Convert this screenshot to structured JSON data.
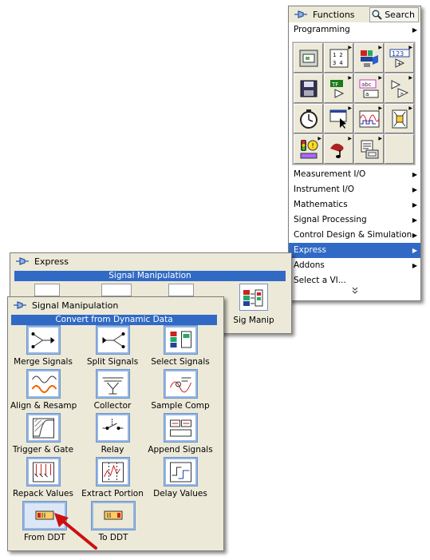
{
  "functions": {
    "title": "Functions",
    "search_label": "Search",
    "top_item": "Programming",
    "items": [
      "Measurement I/O",
      "Instrument I/O",
      "Mathematics",
      "Signal Processing",
      "Control Design & Simulation",
      "Express",
      "Addons",
      "Select a VI..."
    ],
    "selected_index": 5,
    "more_glyph": "»",
    "icons": [
      "structures-icon",
      "array-icon",
      "cluster-icon",
      "numeric-icon",
      "file-io-icon",
      "boolean-icon",
      "string-icon",
      "comparison-icon",
      "timing-icon",
      "dialog-icon",
      "waveform-icon",
      "application-control-icon",
      "synchronization-icon",
      "graphics-sound-icon",
      "report-generation-icon"
    ]
  },
  "express": {
    "title": "Express",
    "band": "Signal Manipulation",
    "partial_label": "Sig Manip"
  },
  "signal_manip": {
    "title": "Signal Manipulation",
    "band": "Convert from Dynamic Data",
    "tiles": [
      "Merge Signals",
      "Split Signals",
      "Select Signals",
      "Align & Resamp",
      "Collector",
      "Sample Comp",
      "Trigger & Gate",
      "Relay",
      "Append Signals",
      "Repack Values",
      "Extract Portion",
      "Delay Values",
      "From DDT",
      "To DDT"
    ]
  },
  "colors": {
    "selection": "#316ac5",
    "palette_bg": "#ece9d8",
    "arrow": "#cc1010"
  }
}
